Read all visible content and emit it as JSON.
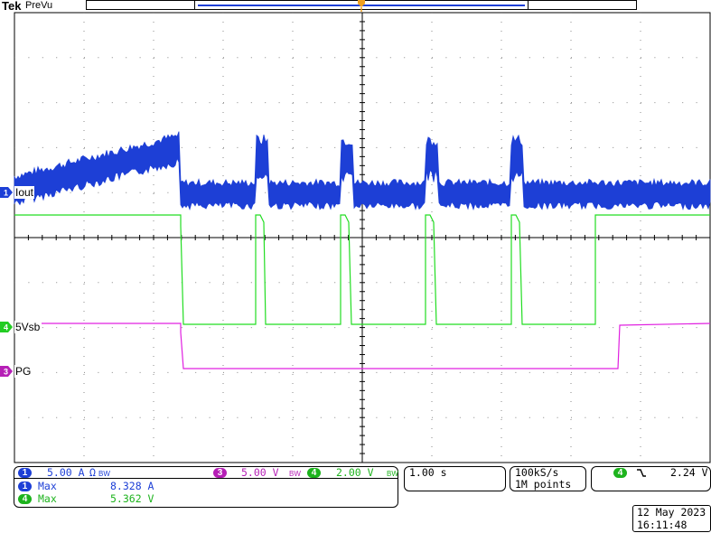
{
  "header": {
    "brand": "Tek",
    "mode": "PreVu"
  },
  "channel_labels": {
    "ch1": "Iout",
    "ch4": "5Vsb",
    "ch3": "PG"
  },
  "settings": {
    "ch1_num": "1",
    "ch1_scale": "5.00 A",
    "ch1_coupling": "Ω",
    "ch1_bw": "BW",
    "ch3_num": "3",
    "ch3_scale": "5.00 V",
    "ch3_bw": "BW",
    "ch4_num": "4",
    "ch4_scale": "2.00 V",
    "ch4_bw": "BW",
    "timebase": "1.00 s",
    "sample_rate": "100kS/s",
    "record_length": "1M points",
    "trigger_source": "4",
    "trigger_slope": "falling",
    "trigger_level": "2.24 V"
  },
  "measurements": [
    {
      "channel": "1",
      "name": "Max",
      "value": "8.328 A"
    },
    {
      "channel": "4",
      "name": "Max",
      "value": "5.362 V"
    }
  ],
  "datetime": {
    "date": "12 May 2023",
    "time": "16:11:48"
  },
  "colors": {
    "ch1": "#1d3fd6",
    "ch3": "#e020e0",
    "ch4": "#22dd22",
    "grid": "#000000"
  }
}
